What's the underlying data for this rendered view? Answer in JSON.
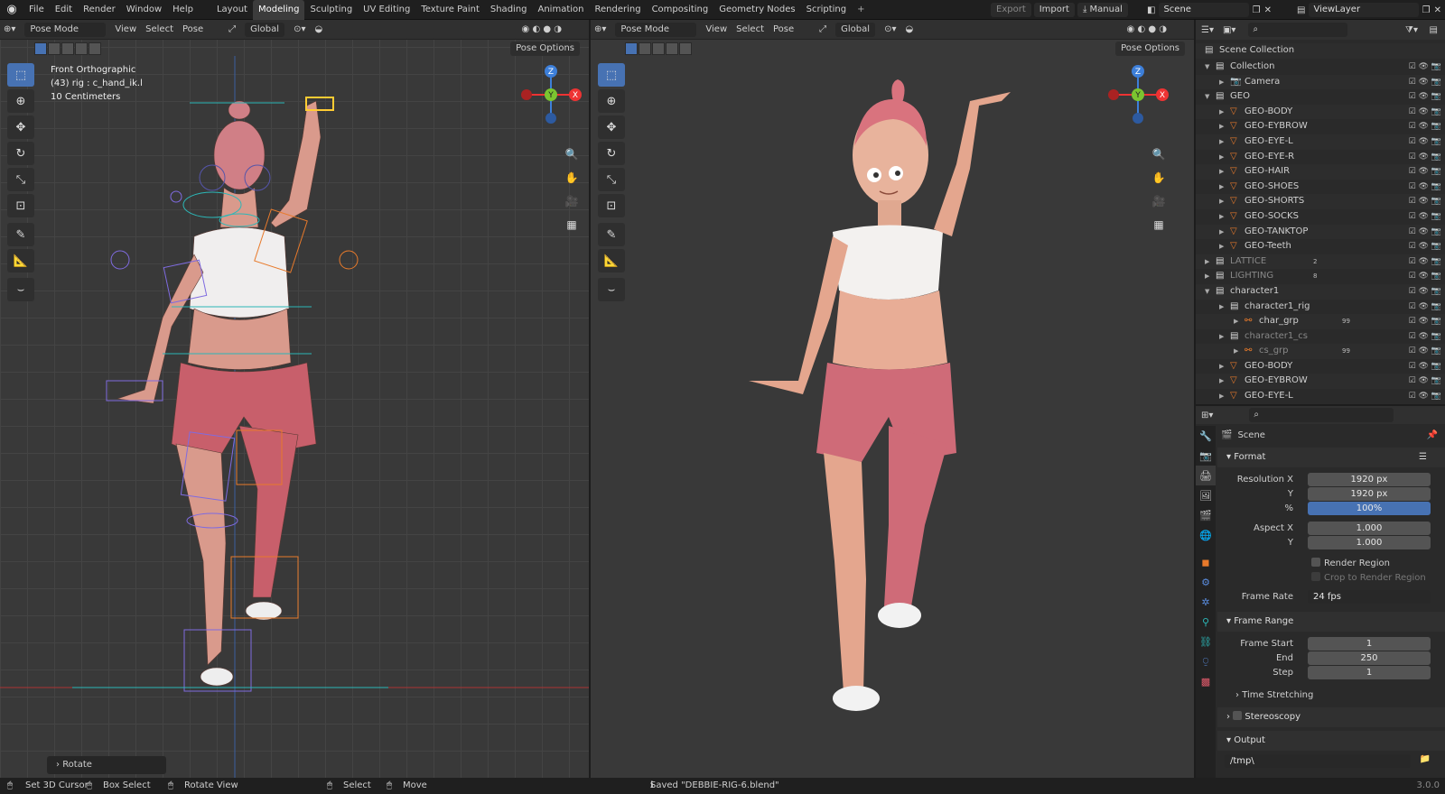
{
  "topbar": {
    "menus": [
      "File",
      "Edit",
      "Render",
      "Window",
      "Help"
    ],
    "workspaces": [
      "Layout",
      "Modeling",
      "Sculpting",
      "UV Editing",
      "Texture Paint",
      "Shading",
      "Animation",
      "Rendering",
      "Compositing",
      "Geometry Nodes",
      "Scripting"
    ],
    "active_workspace": "Modeling",
    "add_tab": "+",
    "export_label": "Export",
    "import_label": "Import",
    "manual_label": "Manual",
    "scene_name": "Scene",
    "view_layer": "ViewLayer"
  },
  "left_viewport": {
    "mode": "Pose Mode",
    "menus": [
      "View",
      "Select",
      "Pose"
    ],
    "orientation": "Global",
    "pose_options": "Pose Options",
    "info_view": "Front Orthographic",
    "info_object": "(43) rig : c_hand_ik.l",
    "info_scale": "10 Centimeters",
    "redo_panel": "Rotate"
  },
  "right_viewport": {
    "mode": "Pose Mode",
    "menus": [
      "View",
      "Select",
      "Pose"
    ],
    "orientation": "Global",
    "pose_options": "Pose Options"
  },
  "gizmo": {
    "z": "Z",
    "y": "Y",
    "x": "X"
  },
  "outliner": {
    "root": "Scene Collection",
    "rows": [
      {
        "label": "Collection",
        "indent": 1,
        "type": "collection",
        "open": true
      },
      {
        "label": "Camera",
        "indent": 2,
        "type": "camera"
      },
      {
        "label": "GEO",
        "indent": 1,
        "type": "collection",
        "open": true
      },
      {
        "label": "GEO-BODY",
        "indent": 2,
        "type": "mesh"
      },
      {
        "label": "GEO-EYBROW",
        "indent": 2,
        "type": "mesh"
      },
      {
        "label": "GEO-EYE-L",
        "indent": 2,
        "type": "mesh"
      },
      {
        "label": "GEO-EYE-R",
        "indent": 2,
        "type": "mesh"
      },
      {
        "label": "GEO-HAIR",
        "indent": 2,
        "type": "mesh"
      },
      {
        "label": "GEO-SHOES",
        "indent": 2,
        "type": "mesh"
      },
      {
        "label": "GEO-SHORTS",
        "indent": 2,
        "type": "mesh"
      },
      {
        "label": "GEO-SOCKS",
        "indent": 2,
        "type": "mesh"
      },
      {
        "label": "GEO-TANKTOP",
        "indent": 2,
        "type": "mesh"
      },
      {
        "label": "GEO-Teeth",
        "indent": 2,
        "type": "mesh"
      },
      {
        "label": "LATTICE",
        "indent": 1,
        "type": "collection",
        "dim": true,
        "count": "2"
      },
      {
        "label": "LIGHTING",
        "indent": 1,
        "type": "collection",
        "dim": true,
        "count": "8"
      },
      {
        "label": "character1",
        "indent": 1,
        "type": "collection",
        "open": true
      },
      {
        "label": "character1_rig",
        "indent": 2,
        "type": "collection"
      },
      {
        "label": "char_grp",
        "indent": 3,
        "type": "empty",
        "count": "99"
      },
      {
        "label": "character1_cs",
        "indent": 2,
        "type": "collection",
        "dim": true
      },
      {
        "label": "cs_grp",
        "indent": 3,
        "type": "empty",
        "dim": true,
        "count": "99"
      },
      {
        "label": "GEO-BODY",
        "indent": 2,
        "type": "mesh"
      },
      {
        "label": "GEO-EYBROW",
        "indent": 2,
        "type": "mesh"
      },
      {
        "label": "GEO-EYE-L",
        "indent": 2,
        "type": "mesh"
      }
    ]
  },
  "properties": {
    "context": "Scene",
    "format_panel": "Format",
    "resolution_x_label": "Resolution X",
    "resolution_x": "1920 px",
    "resolution_y_label": "Y",
    "resolution_y": "1920 px",
    "percent_label": "%",
    "percent": "100%",
    "aspect_x_label": "Aspect X",
    "aspect_x": "1.000",
    "aspect_y_label": "Y",
    "aspect_y": "1.000",
    "render_region": "Render Region",
    "crop_region": "Crop to Render Region",
    "frame_rate_label": "Frame Rate",
    "frame_rate": "24 fps",
    "frame_range_panel": "Frame Range",
    "frame_start_label": "Frame Start",
    "frame_start": "1",
    "end_label": "End",
    "end": "250",
    "step_label": "Step",
    "step": "1",
    "time_stretching": "Time Stretching",
    "stereoscopy": "Stereoscopy",
    "output_panel": "Output",
    "output_path": "/tmp\\"
  },
  "status": {
    "set_cursor": "Set 3D Cursor",
    "box_select": "Box Select",
    "rotate_view": "Rotate View",
    "select": "Select",
    "move": "Move",
    "message": "Saved \"DEBBIE-RIG-6.blend\"",
    "version": "3.0.0"
  }
}
